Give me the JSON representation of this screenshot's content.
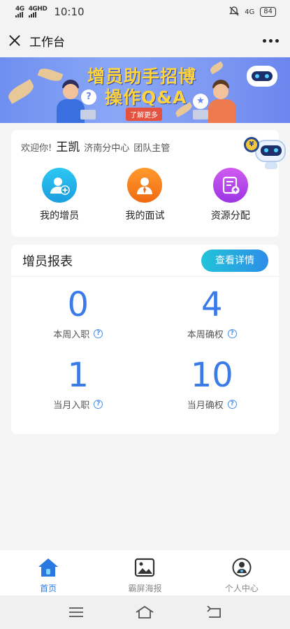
{
  "status_bar": {
    "time": "10:10",
    "network1": "4G",
    "network2": "4GHD",
    "network3": "4G",
    "battery": "84"
  },
  "nav": {
    "title": "工作台"
  },
  "banner": {
    "headline_line1": "增员助手招博",
    "headline_line2": "操作Q&A",
    "cta": "了解更多"
  },
  "welcome": {
    "greeting": "欢迎你!",
    "name": "王凯",
    "department": "济南分中心",
    "role": "团队主管",
    "actions": [
      {
        "label": "我的增员",
        "icon": "add-user-icon",
        "color": "#1ea6e6"
      },
      {
        "label": "我的面试",
        "icon": "interviewer-icon",
        "color": "#f27a1b"
      },
      {
        "label": "资源分配",
        "icon": "resource-assign-icon",
        "color": "#b547ea"
      }
    ]
  },
  "report": {
    "title": "增员报表",
    "detail_button": "查看详情",
    "stats": [
      {
        "value": "0",
        "label": "本周入职"
      },
      {
        "value": "4",
        "label": "本周确权"
      },
      {
        "value": "1",
        "label": "当月入职"
      },
      {
        "value": "10",
        "label": "当月确权"
      }
    ]
  },
  "tabs": [
    {
      "label": "首页",
      "icon": "home-icon",
      "active": true
    },
    {
      "label": "霸屏海报",
      "icon": "poster-icon",
      "active": false
    },
    {
      "label": "个人中心",
      "icon": "profile-icon",
      "active": false
    }
  ],
  "colors": {
    "accent": "#3b7be8",
    "tab_active": "#2a79e0",
    "banner": "#7f9af2"
  }
}
